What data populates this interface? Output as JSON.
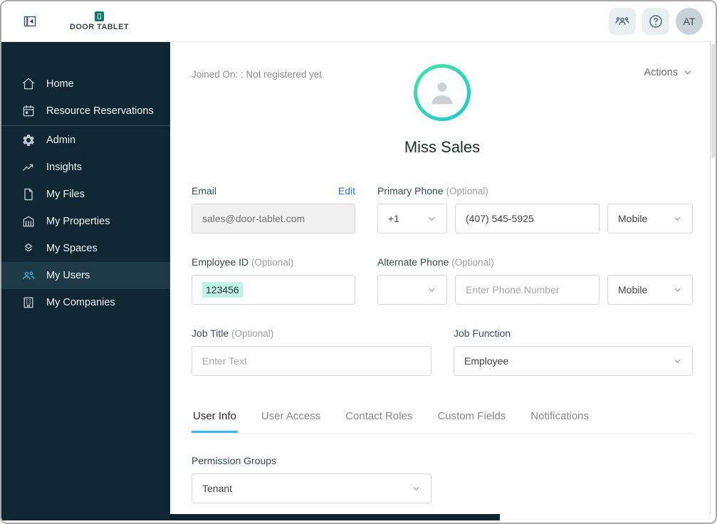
{
  "topbar": {
    "logo_text": "DOOR TABLET",
    "avatar_initials": "AT"
  },
  "sidebar": {
    "items": [
      {
        "label": "Home",
        "icon": "home-icon"
      },
      {
        "label": "Resource Reservations",
        "icon": "calendar-icon"
      },
      {
        "label": "Admin",
        "icon": "gear-icon"
      },
      {
        "label": "Insights",
        "icon": "insights-icon"
      },
      {
        "label": "My Files",
        "icon": "file-icon"
      },
      {
        "label": "My Properties",
        "icon": "building-icon"
      },
      {
        "label": "My Spaces",
        "icon": "layers-icon"
      },
      {
        "label": "My Users",
        "icon": "users-icon",
        "selected": true
      },
      {
        "label": "My Companies",
        "icon": "office-icon"
      }
    ]
  },
  "profile": {
    "joined_on": "Joined On: : Not registered yet",
    "actions_label": "Actions",
    "name": "Miss Sales"
  },
  "form": {
    "email": {
      "label": "Email",
      "edit_label": "Edit",
      "value": "sales@door-tablet.com"
    },
    "primary_phone": {
      "label": "Primary Phone",
      "optional": "(Optional)",
      "country_code": "+1",
      "number": "(407) 545-5925",
      "type": "Mobile"
    },
    "employee_id": {
      "label": "Employee ID",
      "optional": "(Optional)",
      "value": "123456"
    },
    "alternate_phone": {
      "label": "Alternate Phone",
      "optional": "(Optional)",
      "country_code": "",
      "placeholder": "Enter Phone Number",
      "type": "Mobile"
    },
    "job_title": {
      "label": "Job Title",
      "optional": "(Optional)",
      "placeholder": "Enter Text"
    },
    "job_function": {
      "label": "Job Function",
      "value": "Employee"
    },
    "permission_groups": {
      "label": "Permission Groups",
      "value": "Tenant"
    }
  },
  "tabs": [
    {
      "label": "User Info",
      "active": true
    },
    {
      "label": "User Access",
      "active": false
    },
    {
      "label": "Contact Roles",
      "active": false
    },
    {
      "label": "Custom Fields",
      "active": false
    },
    {
      "label": "Notifications",
      "active": false
    }
  ],
  "colors": {
    "sidebar_bg": "#0e2733",
    "sidebar_selected_bg": "#1d3a46",
    "sidebar_selected_icon": "#4aa7da",
    "avatar_ring_start": "#3fe49e",
    "avatar_ring_end": "#1fc6d4",
    "tab_underline": "#35b8f5",
    "edit_link": "#2a6ff0",
    "employee_id_highlight": "#bdf4e4",
    "brand_teal": "#10796a"
  }
}
